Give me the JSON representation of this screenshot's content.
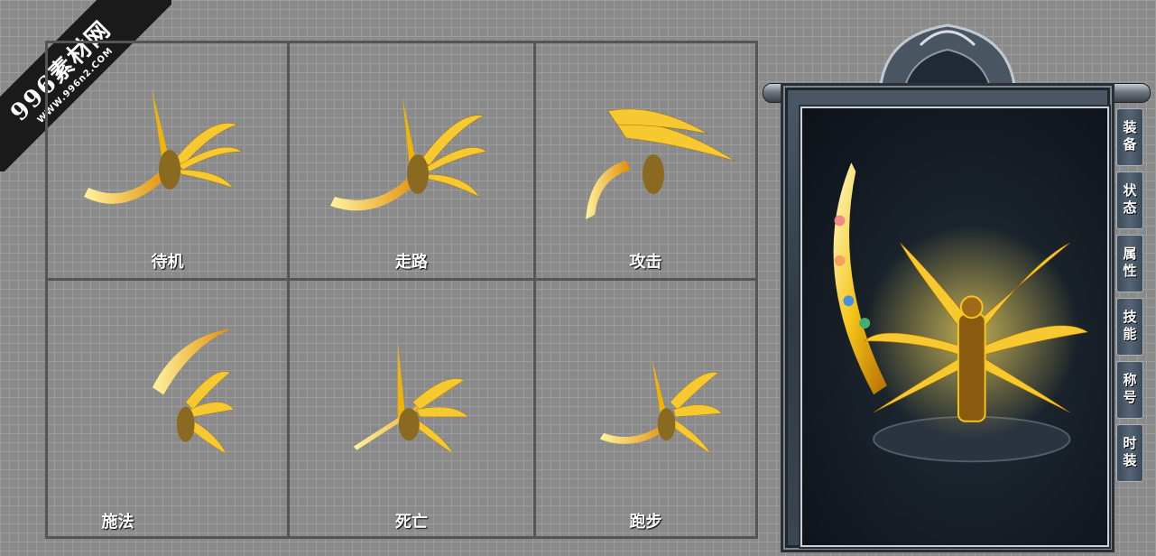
{
  "watermark": {
    "main": "996素材网",
    "sub": "WWW.996n2.COM"
  },
  "actions": [
    {
      "label": "待机"
    },
    {
      "label": "走路"
    },
    {
      "label": "攻击"
    },
    {
      "label": "施法"
    },
    {
      "label": "死亡"
    },
    {
      "label": "跑步"
    }
  ],
  "panel": {
    "tabs": [
      {
        "label": "装备"
      },
      {
        "label": "状态"
      },
      {
        "label": "属性"
      },
      {
        "label": "技能"
      },
      {
        "label": "称号"
      },
      {
        "label": "时装"
      }
    ]
  },
  "colors": {
    "background": "#8a8a8a",
    "grid_line": "#555555",
    "gold": "#f5c518",
    "panel_dark": "#151c24"
  }
}
